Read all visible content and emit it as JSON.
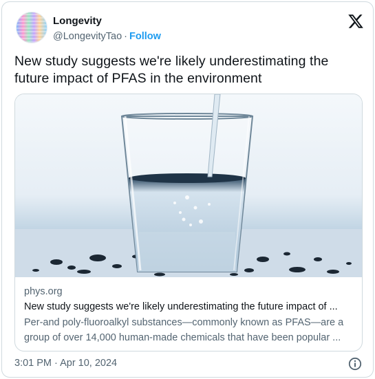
{
  "account": {
    "display_name": "Longevity",
    "handle": "@LongevityTao",
    "separator": "·",
    "follow_label": "Follow"
  },
  "platform_icon": "x-logo-icon",
  "tweet": {
    "text": "New study suggests we're likely underestimating the future impact of PFAS in the environment"
  },
  "card": {
    "image_icon": "water-glass-photo",
    "domain": "phys.org",
    "title": "New study suggests we're likely underestimating the future impact of ...",
    "description": "Per-and poly-fluoroalkyl substances—commonly known as PFAS—are a group of over 14,000 human-made chemicals that have been popular ..."
  },
  "footer": {
    "timestamp": "3:01 PM · Apr 10, 2024",
    "info_icon": "info-icon"
  },
  "colors": {
    "link_blue": "#1d9bf0",
    "secondary_text": "#536471",
    "border": "#cfd9de"
  }
}
